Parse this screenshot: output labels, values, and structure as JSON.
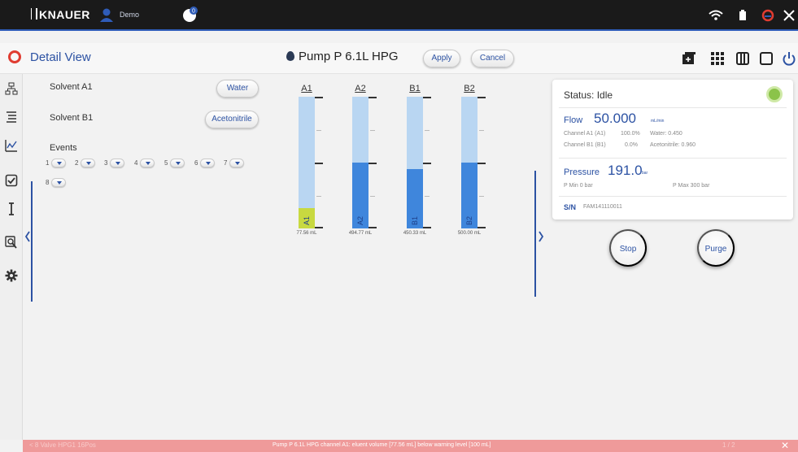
{
  "topbar": {
    "logo_text": "KNAUER",
    "user_name": "Demo",
    "notification_count": "0"
  },
  "header": {
    "title": "Detail View",
    "pump_title": "Pump P 6.1L HPG",
    "apply_label": "Apply",
    "cancel_label": "Cancel"
  },
  "solvents": {
    "a1_label": "Solvent A1",
    "a1_value": "Water",
    "b1_label": "Solvent B1",
    "b1_value": "Acetonitrile"
  },
  "events": {
    "label": "Events",
    "numbers": [
      "1",
      "2",
      "3",
      "4",
      "5",
      "6",
      "7",
      "8"
    ]
  },
  "bottles": [
    {
      "name": "A1",
      "volume_label": "77.56 mL",
      "fill_fraction": 0.155,
      "warning": true
    },
    {
      "name": "A2",
      "volume_label": "494.77 mL",
      "fill_fraction": 0.5,
      "warning": false
    },
    {
      "name": "B1",
      "volume_label": "450.33 mL",
      "fill_fraction": 0.45,
      "warning": false
    },
    {
      "name": "B2",
      "volume_label": "500.00 mL",
      "fill_fraction": 0.5,
      "warning": false
    }
  ],
  "status": {
    "title": "Status: Idle",
    "flow_label": "Flow",
    "flow_value": "50.000",
    "flow_unit": "mL/min",
    "channel_a_label": "Channel A1 (A1)",
    "channel_a_percent": "100.0%",
    "channel_a_solvent": "Water: 0.450",
    "channel_b_label": "Channel B1 (B1)",
    "channel_b_percent": "0.0%",
    "channel_b_solvent": "Acetonitrile: 0.960",
    "pressure_label": "Pressure",
    "pressure_value": "191.0",
    "pressure_unit": "bar",
    "pmin": "P Min 0 bar",
    "pmax": "P Max 300 bar",
    "sn_label": "S/N",
    "sn_value": "FAM141110011"
  },
  "actions": {
    "stop_label": "Stop",
    "purge_label": "Purge"
  },
  "warning": {
    "left_text": "< 8 Valve HPG1 16Pos",
    "message": "Pump P 6.1L HPG channel A1: eluent volume [77.56 mL] below warning level [100 mL]",
    "right_text": "1 / 2",
    "close": "✕"
  },
  "colors": {
    "accent": "#2c52a3",
    "topbar": "#1a1a1a",
    "bottle_empty": "#b9d6f2",
    "bottle_fill": "#3f86dc",
    "bottle_warning": "#c8d940",
    "warning_bar": "#ef9a9a",
    "status_led": "#8bc34a"
  },
  "icons": [
    "wifi-icon",
    "battery-icon",
    "knauer-logo-icon",
    "close-icon",
    "add-panel-icon",
    "grid-icon",
    "columns-icon",
    "window-icon",
    "power-icon",
    "network-icon",
    "list-icon",
    "chart-icon",
    "checkbox-icon",
    "text-cursor-icon",
    "search-icon",
    "gear-icon"
  ]
}
